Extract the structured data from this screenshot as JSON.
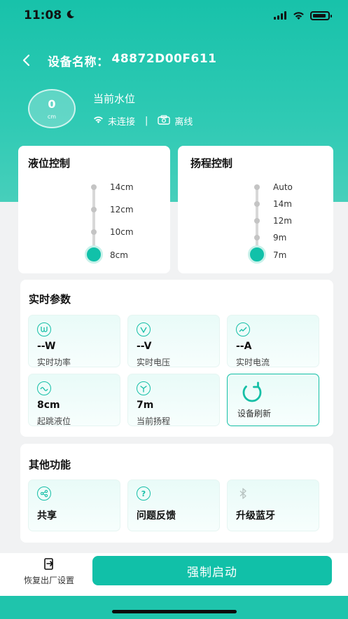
{
  "status_bar": {
    "time": "11:08"
  },
  "header": {
    "title_label": "设备名称：",
    "device_id": "48872D00F611"
  },
  "water_level": {
    "value": "0",
    "unit": "cm",
    "label": "当前水位"
  },
  "connection": {
    "wifi_status": "未连接",
    "separator": "|",
    "online_status": "离线"
  },
  "level_control": {
    "title": "液位控制",
    "options": [
      "14cm",
      "12cm",
      "10cm",
      "8cm"
    ],
    "selected_index": 3
  },
  "head_control": {
    "title": "扬程控制",
    "options": [
      "Auto",
      "14m",
      "12m",
      "9m",
      "7m"
    ],
    "selected_index": 4
  },
  "realtime_params": {
    "title": "实时参数",
    "tiles": [
      {
        "icon": "power-icon",
        "value": "--W",
        "name": "实时功率"
      },
      {
        "icon": "voltage-icon",
        "value": "--V",
        "name": "实时电压"
      },
      {
        "icon": "current-icon",
        "value": "--A",
        "name": "实时电流"
      },
      {
        "icon": "wave-level-icon",
        "value": "8cm",
        "name": "起跳液位"
      },
      {
        "icon": "fan-icon",
        "value": "7m",
        "name": "当前扬程"
      }
    ],
    "refresh_label": "设备刷新"
  },
  "other_functions": {
    "title": "其他功能",
    "items": [
      {
        "icon": "share-icon",
        "label": "共享"
      },
      {
        "icon": "question-icon",
        "label": "问题反馈"
      },
      {
        "icon": "bluetooth-icon",
        "label": "升级蓝牙"
      }
    ]
  },
  "bottom": {
    "reset_label": "恢复出厂设置",
    "force_start_label": "强制启动"
  },
  "colors": {
    "accent": "#11c0a8",
    "hero_top": "#18c2aa"
  }
}
